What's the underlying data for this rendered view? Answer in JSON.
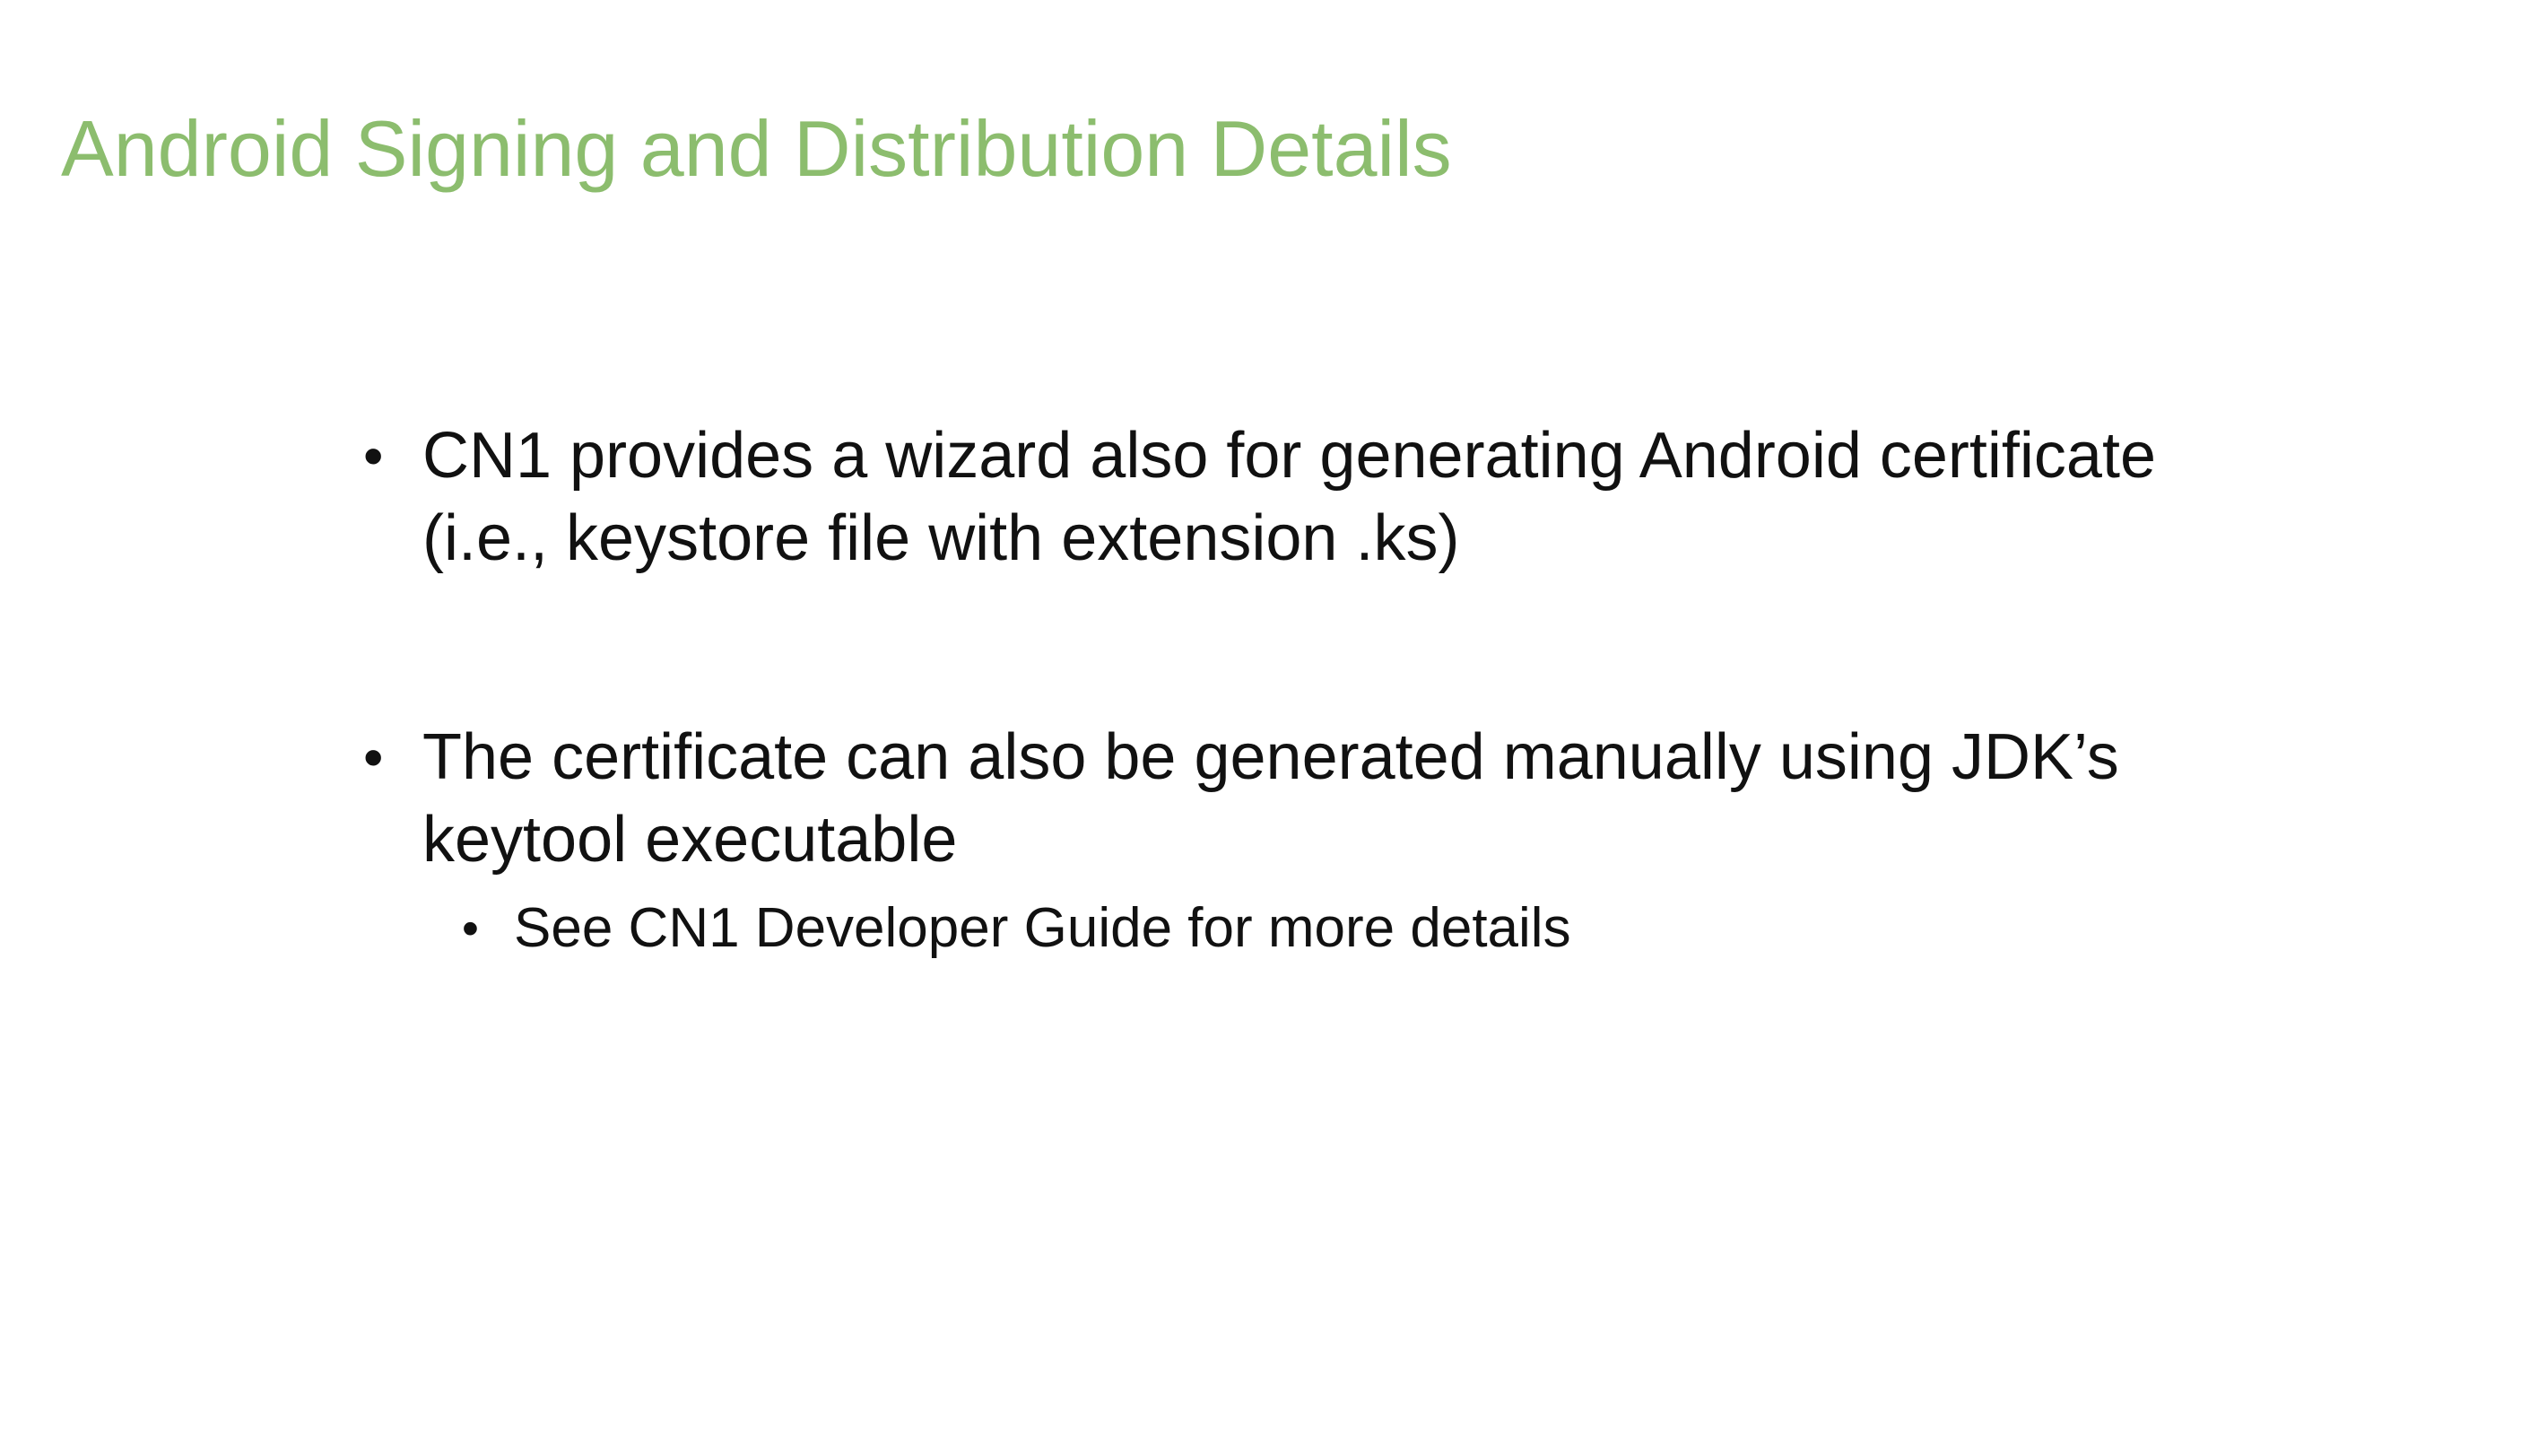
{
  "slide": {
    "title": "Android Signing and Distribution Details",
    "title_color": "#8cbd6e",
    "bullets": [
      {
        "text": "CN1 provides a wizard also for generating Android certificate (i.e., keystore file with extension .ks)"
      },
      {
        "text": "The certificate can also be generated manually using JDK’s keytool executable",
        "sub_bullets": [
          {
            "text": "See CN1 Developer Guide for more details"
          }
        ]
      }
    ],
    "bullet_symbol": "•"
  }
}
